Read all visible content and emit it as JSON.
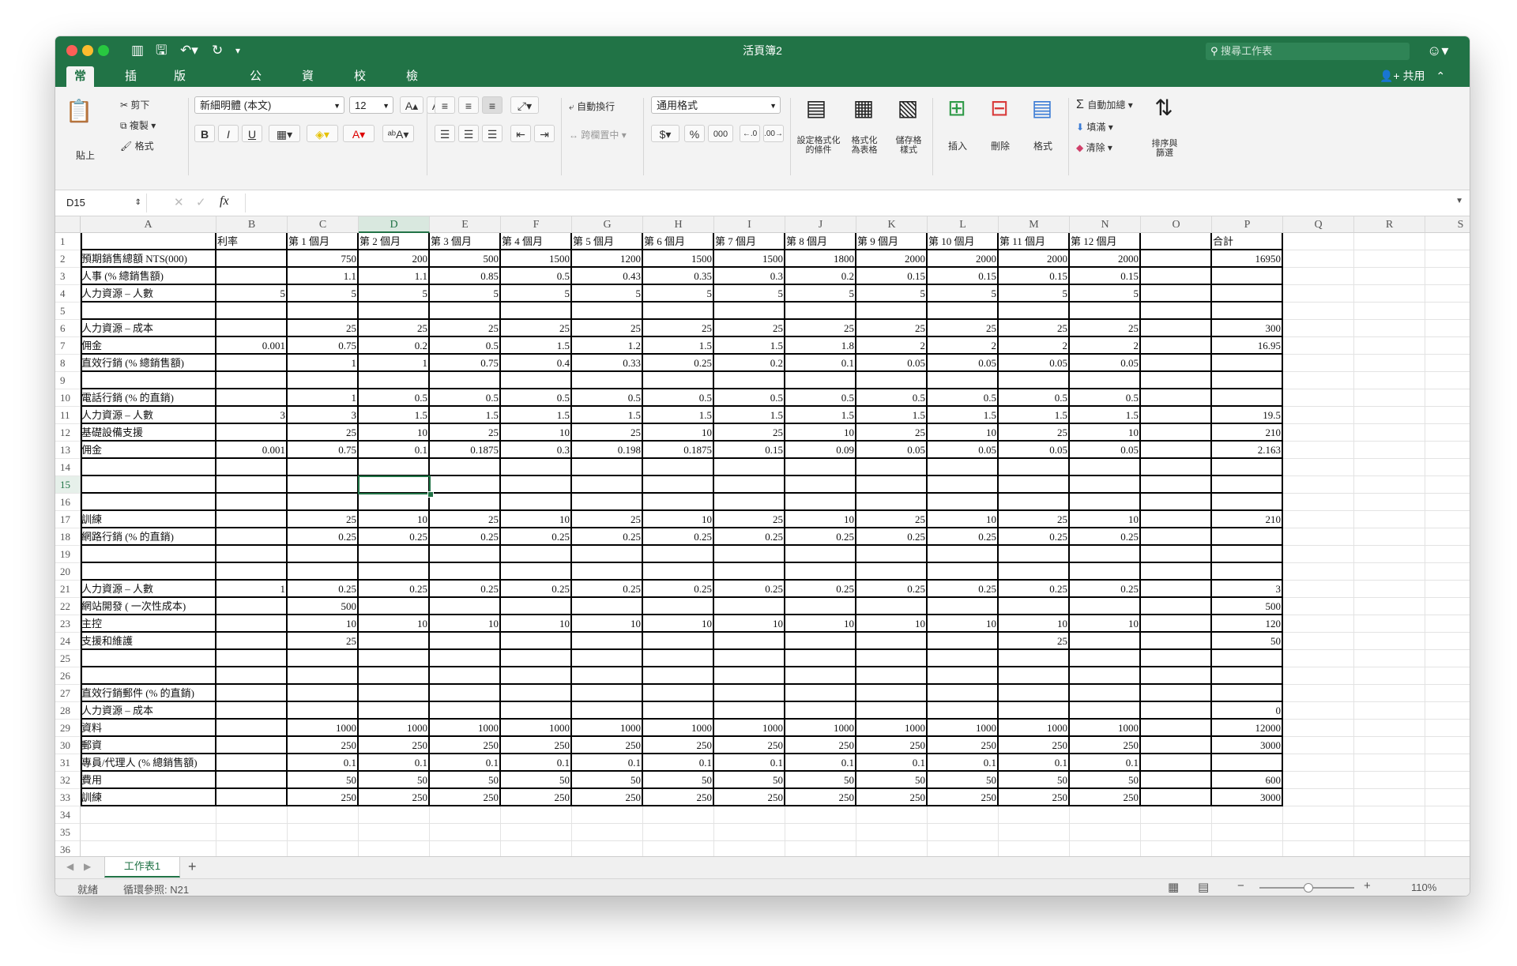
{
  "window": {
    "title": "活頁簿2",
    "search_placeholder": "搜尋工作表"
  },
  "menu_tabs": [
    "常用",
    "插入",
    "版面配置",
    "公式",
    "資料",
    "校閱",
    "檢視"
  ],
  "share_label": "共用",
  "ribbon": {
    "paste": "貼上",
    "cut": "剪下",
    "copy": "複製",
    "format_painter": "格式",
    "font_name": "新細明體 (本文)",
    "font_size": "12",
    "wrap_text": "自動換行",
    "merge_center": "跨欄置中",
    "number_format": "通用格式",
    "conditional_format": "設定格式化的條件",
    "format_as_table": "格式化為表格",
    "cell_styles": "儲存格樣式",
    "insert": "插入",
    "delete": "刪除",
    "format": "格式",
    "autosum": "自動加總",
    "fill": "填滿",
    "clear": "清除",
    "sort_filter": "排序與篩選"
  },
  "formula_bar": {
    "name_box": "D15",
    "fx": "fx",
    "value": ""
  },
  "columns": [
    "A",
    "B",
    "C",
    "D",
    "E",
    "F",
    "G",
    "H",
    "I",
    "J",
    "K",
    "L",
    "M",
    "N",
    "O",
    "P",
    "Q",
    "R",
    "S"
  ],
  "selected_column": "D",
  "selected_row": 15,
  "rows": [
    {
      "n": 1,
      "cells": [
        "",
        "利率",
        "第 1 個月",
        "第 2 個月",
        "第 3 個月",
        "第 4 個月",
        "第 5 個月",
        "第 6 個月",
        "第 7 個月",
        "第 8 個月",
        "第 9 個月",
        "第 10 個月",
        "第 11 個月",
        "第 12 個月",
        "",
        "合計"
      ]
    },
    {
      "n": 2,
      "cells": [
        "預期銷售總額 NTS(000)",
        "",
        "750",
        "200",
        "500",
        "1500",
        "1200",
        "1500",
        "1500",
        "1800",
        "2000",
        "2000",
        "2000",
        "2000",
        "",
        "16950"
      ]
    },
    {
      "n": 3,
      "cells": [
        "人事 (% 總銷售額)",
        "",
        "1.1",
        "1.1",
        "0.85",
        "0.5",
        "0.43",
        "0.35",
        "0.3",
        "0.2",
        "0.15",
        "0.15",
        "0.15",
        "0.15",
        "",
        ""
      ]
    },
    {
      "n": 4,
      "cells": [
        "人力資源 – 人數",
        "5",
        "5",
        "5",
        "5",
        "5",
        "5",
        "5",
        "5",
        "5",
        "5",
        "5",
        "5",
        "5",
        "",
        ""
      ]
    },
    {
      "n": 5,
      "cells": [
        "",
        "",
        "",
        "",
        "",
        "",
        "",
        "",
        "",
        "",
        "",
        "",
        "",
        "",
        "",
        ""
      ]
    },
    {
      "n": 6,
      "cells": [
        "人力資源 – 成本",
        "",
        "25",
        "25",
        "25",
        "25",
        "25",
        "25",
        "25",
        "25",
        "25",
        "25",
        "25",
        "25",
        "",
        "300"
      ]
    },
    {
      "n": 7,
      "cells": [
        "佣金",
        "0.001",
        "0.75",
        "0.2",
        "0.5",
        "1.5",
        "1.2",
        "1.5",
        "1.5",
        "1.8",
        "2",
        "2",
        "2",
        "2",
        "",
        "16.95"
      ]
    },
    {
      "n": 8,
      "cells": [
        "直效行銷 (% 總銷售額)",
        "",
        "1",
        "1",
        "0.75",
        "0.4",
        "0.33",
        "0.25",
        "0.2",
        "0.1",
        "0.05",
        "0.05",
        "0.05",
        "0.05",
        "",
        ""
      ]
    },
    {
      "n": 9,
      "cells": [
        "",
        "",
        "",
        "",
        "",
        "",
        "",
        "",
        "",
        "",
        "",
        "",
        "",
        "",
        "",
        ""
      ]
    },
    {
      "n": 10,
      "cells": [
        "電話行銷 (% 的直銷)",
        "",
        "1",
        "0.5",
        "0.5",
        "0.5",
        "0.5",
        "0.5",
        "0.5",
        "0.5",
        "0.5",
        "0.5",
        "0.5",
        "0.5",
        "",
        ""
      ]
    },
    {
      "n": 11,
      "cells": [
        "人力資源 – 人數",
        "3",
        "3",
        "1.5",
        "1.5",
        "1.5",
        "1.5",
        "1.5",
        "1.5",
        "1.5",
        "1.5",
        "1.5",
        "1.5",
        "1.5",
        "",
        "19.5"
      ]
    },
    {
      "n": 12,
      "cells": [
        "基礎設備支援",
        "",
        "25",
        "10",
        "25",
        "10",
        "25",
        "10",
        "25",
        "10",
        "25",
        "10",
        "25",
        "10",
        "",
        "210"
      ]
    },
    {
      "n": 13,
      "cells": [
        "佣金",
        "0.001",
        "0.75",
        "0.1",
        "0.1875",
        "0.3",
        "0.198",
        "0.1875",
        "0.15",
        "0.09",
        "0.05",
        "0.05",
        "0.05",
        "0.05",
        "",
        "2.163"
      ]
    },
    {
      "n": 14,
      "cells": [
        "",
        "",
        "",
        "",
        "",
        "",
        "",
        "",
        "",
        "",
        "",
        "",
        "",
        "",
        "",
        ""
      ]
    },
    {
      "n": 15,
      "cells": [
        "",
        "",
        "",
        "",
        "",
        "",
        "",
        "",
        "",
        "",
        "",
        "",
        "",
        "",
        "",
        ""
      ]
    },
    {
      "n": 16,
      "cells": [
        "",
        "",
        "",
        "",
        "",
        "",
        "",
        "",
        "",
        "",
        "",
        "",
        "",
        "",
        "",
        ""
      ]
    },
    {
      "n": 17,
      "cells": [
        "訓練",
        "",
        "25",
        "10",
        "25",
        "10",
        "25",
        "10",
        "25",
        "10",
        "25",
        "10",
        "25",
        "10",
        "",
        "210"
      ]
    },
    {
      "n": 18,
      "cells": [
        "網路行銷 (% 的直銷)",
        "",
        "0.25",
        "0.25",
        "0.25",
        "0.25",
        "0.25",
        "0.25",
        "0.25",
        "0.25",
        "0.25",
        "0.25",
        "0.25",
        "0.25",
        "",
        ""
      ]
    },
    {
      "n": 19,
      "cells": [
        "",
        "",
        "",
        "",
        "",
        "",
        "",
        "",
        "",
        "",
        "",
        "",
        "",
        "",
        "",
        ""
      ]
    },
    {
      "n": 20,
      "cells": [
        "",
        "",
        "",
        "",
        "",
        "",
        "",
        "",
        "",
        "",
        "",
        "",
        "",
        "",
        "",
        ""
      ]
    },
    {
      "n": 21,
      "cells": [
        "人力資源 – 人數",
        "1",
        "0.25",
        "0.25",
        "0.25",
        "0.25",
        "0.25",
        "0.25",
        "0.25",
        "0.25",
        "0.25",
        "0.25",
        "0.25",
        "0.25",
        "",
        "3"
      ]
    },
    {
      "n": 22,
      "cells": [
        "網站開發 ( 一次性成本)",
        "",
        "500",
        "",
        "",
        "",
        "",
        "",
        "",
        "",
        "",
        "",
        "",
        "",
        "",
        "500"
      ]
    },
    {
      "n": 23,
      "cells": [
        "主控",
        "",
        "10",
        "10",
        "10",
        "10",
        "10",
        "10",
        "10",
        "10",
        "10",
        "10",
        "10",
        "10",
        "",
        "120"
      ]
    },
    {
      "n": 24,
      "cells": [
        "支援和維護",
        "",
        "25",
        "",
        "",
        "",
        "",
        "",
        "",
        "",
        "",
        "",
        "25",
        "",
        "",
        "50"
      ]
    },
    {
      "n": 25,
      "cells": [
        "",
        "",
        "",
        "",
        "",
        "",
        "",
        "",
        "",
        "",
        "",
        "",
        "",
        "",
        "",
        ""
      ]
    },
    {
      "n": 26,
      "cells": [
        "",
        "",
        "",
        "",
        "",
        "",
        "",
        "",
        "",
        "",
        "",
        "",
        "",
        "",
        "",
        ""
      ]
    },
    {
      "n": 27,
      "cells": [
        "直效行銷郵件 (% 的直銷)",
        "",
        "",
        "",
        "",
        "",
        "",
        "",
        "",
        "",
        "",
        "",
        "",
        "",
        "",
        ""
      ]
    },
    {
      "n": 28,
      "cells": [
        "人力資源 – 成本",
        "",
        "",
        "",
        "",
        "",
        "",
        "",
        "",
        "",
        "",
        "",
        "",
        "",
        "",
        "0"
      ]
    },
    {
      "n": 29,
      "cells": [
        "資料",
        "",
        "1000",
        "1000",
        "1000",
        "1000",
        "1000",
        "1000",
        "1000",
        "1000",
        "1000",
        "1000",
        "1000",
        "1000",
        "",
        "12000"
      ]
    },
    {
      "n": 30,
      "cells": [
        "郵資",
        "",
        "250",
        "250",
        "250",
        "250",
        "250",
        "250",
        "250",
        "250",
        "250",
        "250",
        "250",
        "250",
        "",
        "3000"
      ]
    },
    {
      "n": 31,
      "cells": [
        "專員/代理人 (% 總銷售額)",
        "",
        "0.1",
        "0.1",
        "0.1",
        "0.1",
        "0.1",
        "0.1",
        "0.1",
        "0.1",
        "0.1",
        "0.1",
        "0.1",
        "0.1",
        "",
        ""
      ]
    },
    {
      "n": 32,
      "cells": [
        "費用",
        "",
        "50",
        "50",
        "50",
        "50",
        "50",
        "50",
        "50",
        "50",
        "50",
        "50",
        "50",
        "50",
        "",
        "600"
      ]
    },
    {
      "n": 33,
      "cells": [
        "訓練",
        "",
        "250",
        "250",
        "250",
        "250",
        "250",
        "250",
        "250",
        "250",
        "250",
        "250",
        "250",
        "250",
        "",
        "3000"
      ]
    },
    {
      "n": 34,
      "cells": []
    },
    {
      "n": 35,
      "cells": []
    },
    {
      "n": 36,
      "cells": []
    },
    {
      "n": 37,
      "cells": []
    }
  ],
  "sheet_tabs": [
    "工作表1"
  ],
  "status": {
    "ready": "就緒",
    "circular_ref": "循環參照: N21",
    "zoom": "110%"
  },
  "colors": {
    "accent": "#217346",
    "close": "#fd5f57",
    "minimize": "#fdbc2e",
    "maximize": "#28c840"
  },
  "icons": [
    "undo-icon",
    "redo-icon",
    "save-icon",
    "search-icon",
    "smiley-icon",
    "share-icon",
    "scissors-icon",
    "copy-icon",
    "brush-icon",
    "sigma-icon",
    "sort-icon",
    "fx-icon",
    "add-sheet-icon"
  ]
}
